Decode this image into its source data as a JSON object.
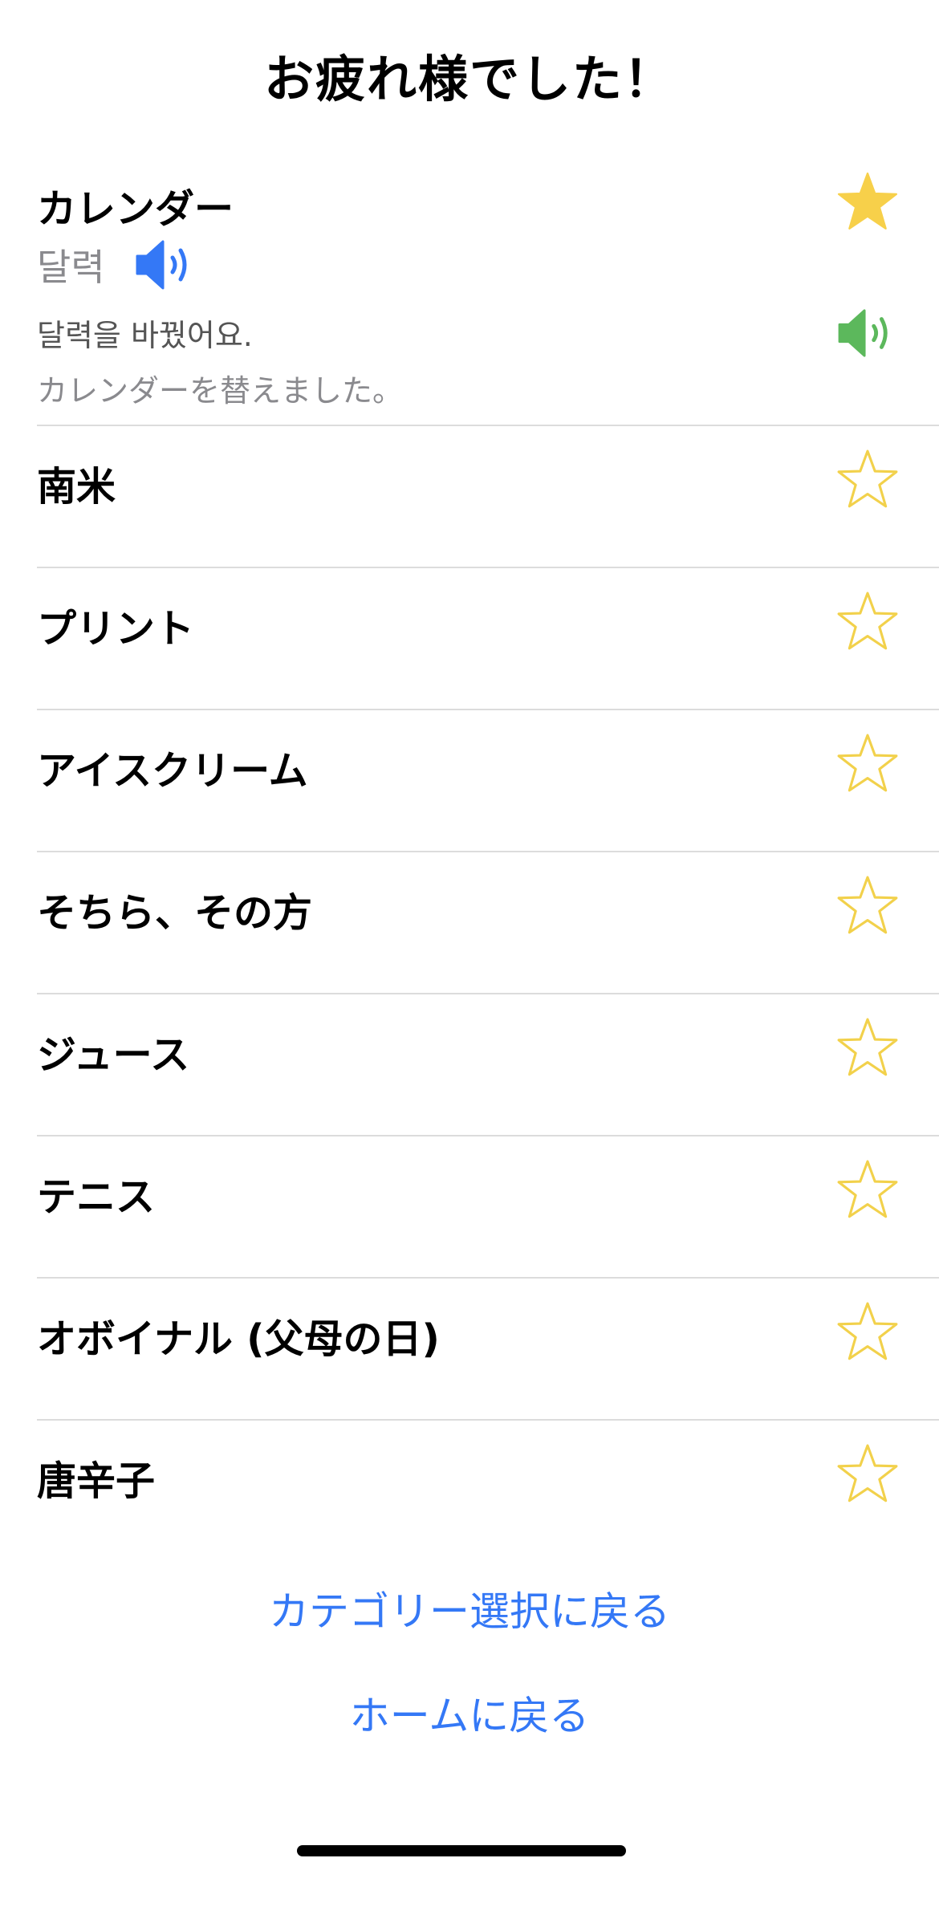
{
  "header": {
    "title": "お疲れ様でした！"
  },
  "words": [
    {
      "term": "カレンダー",
      "favorite": true,
      "expanded": true,
      "translation": "달력",
      "example": "달력을 바꿨어요.",
      "example_translation": "カレンダーを替えました。",
      "translation_audio_icon": "speaker-icon",
      "example_audio_icon": "speaker-icon"
    },
    {
      "term": "南米",
      "favorite": false
    },
    {
      "term": "プリント",
      "favorite": false
    },
    {
      "term": "アイスクリーム",
      "favorite": false
    },
    {
      "term": "そちら、その方",
      "favorite": false
    },
    {
      "term": "ジュース",
      "favorite": false
    },
    {
      "term": "テニス",
      "favorite": false
    },
    {
      "term": "オボイナル (父母の日)",
      "favorite": false
    },
    {
      "term": "唐辛子",
      "favorite": false
    }
  ],
  "footer": {
    "back_to_category": "カテゴリー選択に戻る",
    "back_to_home": "ホームに戻る"
  },
  "colors": {
    "star": "#f7d04a",
    "star_outline": "#f2d14b",
    "link": "#3478f6",
    "speaker_blue": "#3478f6",
    "speaker_green": "#5cb85c",
    "divider": "#dcdcdc",
    "secondary_text": "#8a8a8e"
  }
}
